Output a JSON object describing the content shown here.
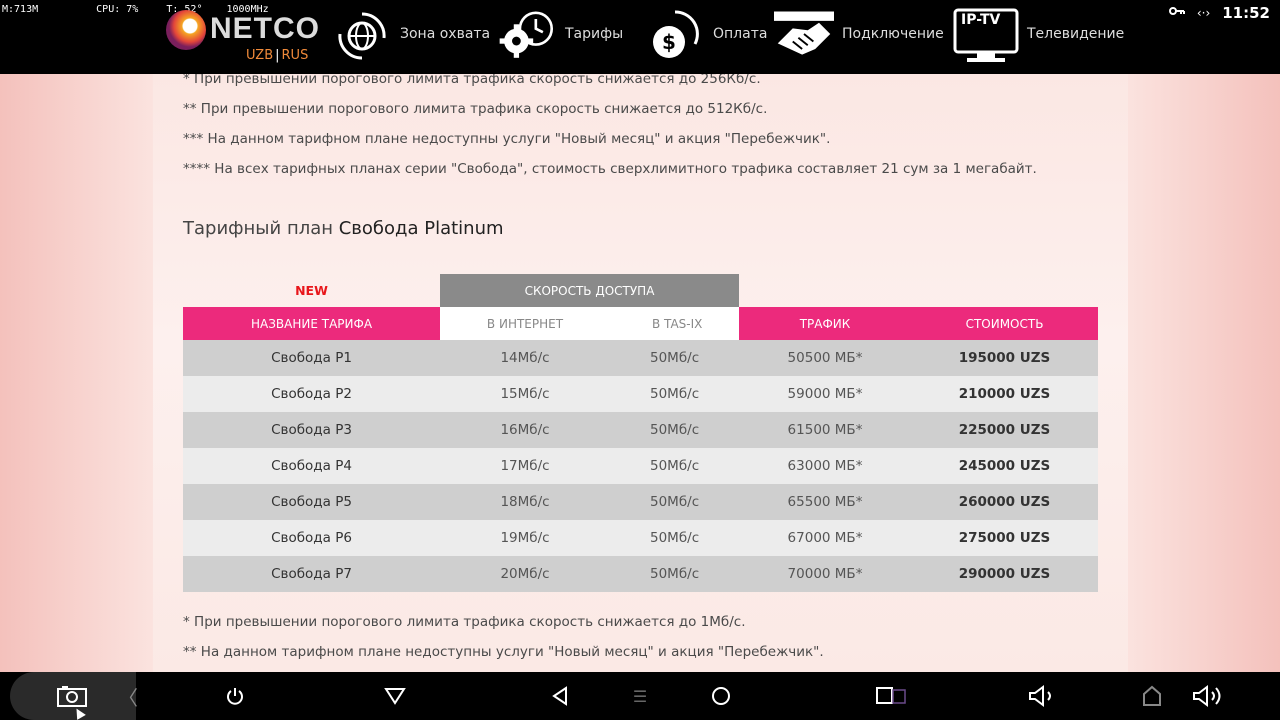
{
  "status": {
    "mem": "M:713M",
    "temp": "T: 52°",
    "cpu": "CPU: 7%",
    "freq": "1000MHz",
    "clock": "11:52"
  },
  "header": {
    "logo_text": "NETCO",
    "lang_uzb": "UZB",
    "lang_sep": "|",
    "lang_rus": "RUS",
    "nav": [
      {
        "label": "Зона охвата",
        "icon": "globe-arrows-icon"
      },
      {
        "label": "Тарифы",
        "icon": "gear-clock-icon"
      },
      {
        "label": "Оплата",
        "icon": "dollar-refresh-icon"
      },
      {
        "label": "Подключение",
        "icon": "handshake-icon"
      },
      {
        "label": "Телевидение",
        "icon": "iptv-monitor-icon"
      }
    ],
    "iptv_label": "IP-TV"
  },
  "notes_top": [
    "* При превышении порогового лимита трафика скорость снижается до 256Кб/с.",
    "** При превышении порогового лимита трафика скорость снижается до 512Кб/с.",
    "*** На данном тарифном плане недоступны услуги \"Новый месяц\" и акция \"Перебежчик\".",
    "**** На всех тарифных планах серии \"Свобода\", стоимость сверхлимитного трафика составляет 21 сум за 1 мегабайт."
  ],
  "plan": {
    "prefix": "Тарифный план ",
    "name": "Свобода Platinum"
  },
  "table": {
    "badge_new": "NEW",
    "speed_group": "СКОРОСТЬ ДОСТУПА",
    "columns": [
      "НАЗВАНИЕ ТАРИФА",
      "В ИНТЕРНЕТ",
      "В TAS-IX",
      "ТРАФИК",
      "СТОИМОСТЬ"
    ],
    "rows": [
      [
        "Свобода P1",
        "14Мб/с",
        "50Мб/с",
        "50500 МБ*",
        "195000 UZS"
      ],
      [
        "Свобода P2",
        "15Мб/с",
        "50Мб/с",
        "59000 МБ*",
        "210000 UZS"
      ],
      [
        "Свобода P3",
        "16Мб/с",
        "50Мб/с",
        "61500 МБ*",
        "225000 UZS"
      ],
      [
        "Свобода P4",
        "17Мб/с",
        "50Мб/с",
        "63000 МБ*",
        "245000 UZS"
      ],
      [
        "Свобода P5",
        "18Мб/с",
        "50Мб/с",
        "65500 МБ*",
        "260000 UZS"
      ],
      [
        "Свобода P6",
        "19Мб/с",
        "50Мб/с",
        "67000 МБ*",
        "275000 UZS"
      ],
      [
        "Свобода P7",
        "20Мб/с",
        "50Мб/с",
        "70000 МБ*",
        "290000 UZS"
      ]
    ]
  },
  "notes_bottom": [
    "* При превышении порогового лимита трафика скорость снижается до 1Мб/с.",
    "** На данном тарифном плане недоступны услуги \"Новый месяц\" и акция \"Перебежчик\"."
  ],
  "colors": {
    "accent_pink": "#ec2a7c",
    "speed_grey": "#8a8a8a",
    "new_red": "#e8161b",
    "row_dark": "#cfcfcf",
    "row_light": "#ececec"
  },
  "bottom_bar": [
    "screenshot-icon",
    "collapse-left-icon",
    "power-icon",
    "hide-nav-icon",
    "back-icon",
    "menu-icon",
    "home-icon",
    "recents-icon",
    "volume-down-icon",
    "home-outline-icon",
    "volume-up-icon"
  ]
}
